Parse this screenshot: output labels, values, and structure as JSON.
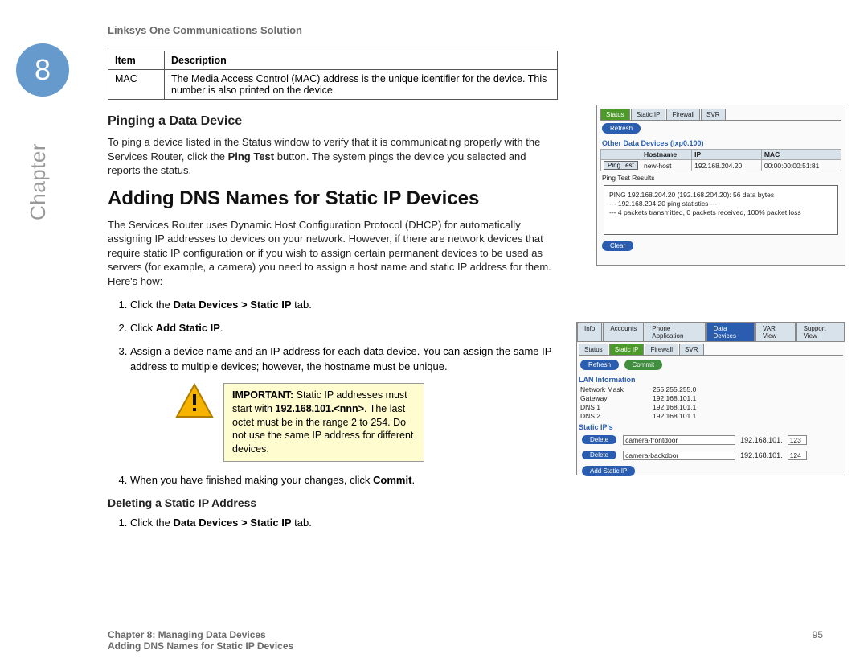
{
  "chapter": {
    "number": "8",
    "label": "Chapter"
  },
  "header": "Linksys One Communications Solution",
  "table": {
    "h1": "Item",
    "h2": "Description",
    "r1c1": "MAC",
    "r1c2": "The Media Access Control (MAC) address is the unique identifier for the device. This number is also printed on the device."
  },
  "sec1_title": "Pinging a Data Device",
  "sec1_p_a": "To ping a device listed in the Status window to verify that it is communicating properly with the Services Router, click the ",
  "sec1_p_b": "Ping Test",
  "sec1_p_c": " button. The system pings the device you selected and reports the status.",
  "sec2_title": "Adding DNS Names for Static IP Devices",
  "sec2_p": "The Services Router uses Dynamic Host Configuration Protocol (DHCP) for automatically assigning IP addresses to devices on your network. However, if there are network devices that require static IP configuration or if you wish to assign certain permanent devices to be used as servers (for example, a camera) you need to assign a host name and static IP address for them. Here's how:",
  "steps": {
    "s1a": "Click the ",
    "s1b": "Data Devices > Static IP",
    "s1c": " tab.",
    "s2a": "Click ",
    "s2b": "Add Static IP",
    "s2c": ".",
    "s3": "Assign a device name and an IP address for each data device. You can assign the same IP address to multiple devices; however, the hostname must be unique.",
    "s4a": "When you have finished making your changes, click ",
    "s4b": "Commit",
    "s4c": "."
  },
  "important": {
    "label": "IMPORTANT: ",
    "a": "Static IP addresses must start with ",
    "b": "192.168.101.<nnn>",
    "c": ". The last octet must be in the range 2 to 254. Do not use the same IP address for different devices."
  },
  "sec3_title": "Deleting a Static IP Address",
  "sec3_s1a": "Click the ",
  "sec3_s1b": "Data Devices > Static IP",
  "sec3_s1c": " tab.",
  "footer": {
    "line1": "Chapter 8: Managing Data Devices",
    "line2": "Adding DNS Names for Static IP Devices",
    "pagenum": "95"
  },
  "shot1": {
    "tabs": {
      "status": "Status",
      "staticip": "Static IP",
      "firewall": "Firewall",
      "svr": "SVR"
    },
    "refresh": "Refresh",
    "title": "Other Data Devices (ixp0.100)",
    "cols": {
      "host": "Hostname",
      "ip": "IP",
      "mac": "MAC"
    },
    "pingtest": "Ping Test",
    "row": {
      "host": "new-host",
      "ip": "192.168.204.20",
      "mac": "00:00:00:00:51:81"
    },
    "results_label": "Ping Test Results",
    "ping1": "PING 192.168.204.20 (192.168.204.20): 56 data bytes",
    "ping2": "--- 192.168.204.20 ping statistics ---",
    "ping3": "--- 4 packets transmitted, 0 packets received, 100% packet loss",
    "clear": "Clear"
  },
  "shot2": {
    "toptabs": {
      "info": "Info",
      "accounts": "Accounts",
      "phone": "Phone Application",
      "data": "Data Devices",
      "var": "VAR View",
      "support": "Support View"
    },
    "tabs": {
      "status": "Status",
      "staticip": "Static IP",
      "firewall": "Firewall",
      "svr": "SVR"
    },
    "refresh": "Refresh",
    "commit": "Commit",
    "lan_title": "LAN Information",
    "lan": {
      "nm_l": "Network Mask",
      "nm_v": "255.255.255.0",
      "gw_l": "Gateway",
      "gw_v": "192.168.101.1",
      "d1_l": "DNS 1",
      "d1_v": "192.168.101.1",
      "d2_l": "DNS 2",
      "d2_v": "192.168.101.1"
    },
    "ips_title": "Static IP's",
    "delete": "Delete",
    "ip_prefix": "192.168.101.",
    "r1_host": "camera-frontdoor",
    "r1_oct": "123",
    "r2_host": "camera-backdoor",
    "r2_oct": "124",
    "add": "Add Static IP"
  }
}
